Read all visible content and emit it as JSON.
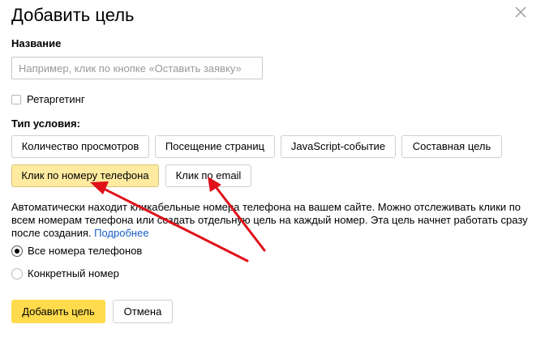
{
  "dialog": {
    "title": "Добавить цель",
    "close_icon": "close-icon"
  },
  "name_field": {
    "label": "Название",
    "value": "",
    "placeholder": "Например, клик по кнопке «Оставить заявку»"
  },
  "retargeting": {
    "label": "Ретаргетинг",
    "checked": false
  },
  "condition_type": {
    "label": "Тип условия:",
    "options": [
      "Количество просмотров",
      "Посещение страниц",
      "JavaScript-событие",
      "Составная цель",
      "Клик по номеру телефона",
      "Клик по email"
    ],
    "selected": "Клик по номеру телефона"
  },
  "description": {
    "text": "Автоматически находит кликабельные номера телефона на вашем сайте. Можно отслеживать клики по всем номерам телефона или создать отдельную цель на каждый номер. Эта цель начнет работать сразу после создания.",
    "link": "Подробнее"
  },
  "phone_scope": {
    "options": [
      "Все номера телефонов",
      "Конкретный номер"
    ],
    "selected": "Все номера телефонов"
  },
  "footer": {
    "submit_label": "Добавить цель",
    "cancel_label": "Отмена"
  },
  "annotation": {
    "arrow_color": "#e0101a"
  }
}
